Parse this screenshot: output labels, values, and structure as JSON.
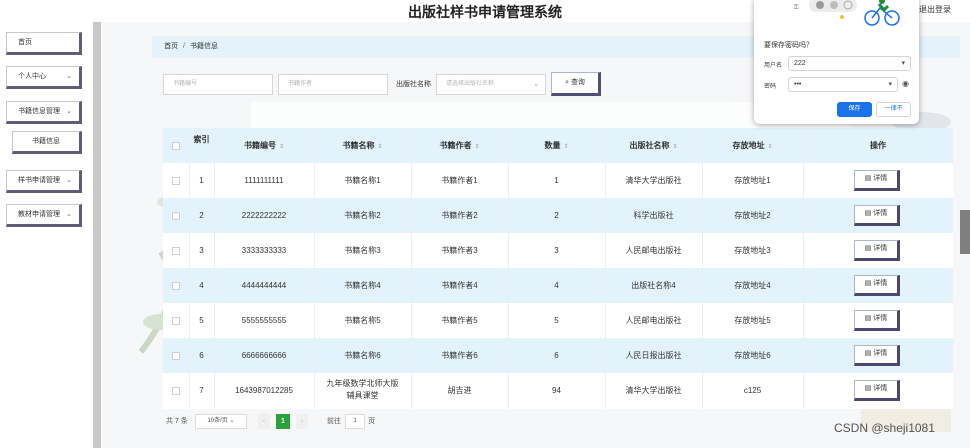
{
  "app": {
    "title": "出版社样书申请管理系统",
    "logout": "退出登录"
  },
  "sidebar": {
    "items": [
      {
        "label": "首页",
        "has_chevron": false,
        "sub": false
      },
      {
        "label": "个人中心",
        "has_chevron": true,
        "sub": false
      },
      {
        "label": "书籍信息管理",
        "has_chevron": true,
        "sub": false
      },
      {
        "label": "书籍信息",
        "has_chevron": false,
        "sub": true
      },
      {
        "label": "样书申请管理",
        "has_chevron": true,
        "sub": false
      },
      {
        "label": "教材申请管理",
        "has_chevron": true,
        "sub": false
      }
    ],
    "chevron_glyph": "⌄"
  },
  "breadcrumb": {
    "home": "首页",
    "separator": "/",
    "current": "书籍信息"
  },
  "filters": {
    "book_no_placeholder": "书籍编号",
    "author_placeholder": "书籍作者",
    "publisher_label": "出版社名称",
    "publisher_placeholder": "请选择出版社名称",
    "query_button": "查询"
  },
  "table": {
    "columns": [
      "索引",
      "书籍编号",
      "书籍名称",
      "书籍作者",
      "数量",
      "出版社名称",
      "存放地址",
      "操作"
    ],
    "rows": [
      {
        "index": "1",
        "book_no": "1111111111",
        "name": "书籍名称1",
        "author": "书籍作者1",
        "qty": "1",
        "publisher": "清华大学出版社",
        "address": "存放地址1"
      },
      {
        "index": "2",
        "book_no": "2222222222",
        "name": "书籍名称2",
        "author": "书籍作者2",
        "qty": "2",
        "publisher": "科学出版社",
        "address": "存放地址2"
      },
      {
        "index": "3",
        "book_no": "3333333333",
        "name": "书籍名称3",
        "author": "书籍作者3",
        "qty": "3",
        "publisher": "人民邮电出版社",
        "address": "存放地址3"
      },
      {
        "index": "4",
        "book_no": "4444444444",
        "name": "书籍名称4",
        "author": "书籍作者4",
        "qty": "4",
        "publisher": "出版社名称4",
        "address": "存放地址4"
      },
      {
        "index": "5",
        "book_no": "5555555555",
        "name": "书籍名称5",
        "author": "书籍作者5",
        "qty": "5",
        "publisher": "人民邮电出版社",
        "address": "存放地址5"
      },
      {
        "index": "6",
        "book_no": "6666666666",
        "name": "书籍名称6",
        "author": "书籍作者6",
        "qty": "6",
        "publisher": "人民日报出版社",
        "address": "存放地址6"
      },
      {
        "index": "7",
        "book_no": "1643987012285",
        "name": "九年级数学北师大版辅具课堂",
        "author": "胡吉进",
        "qty": "94",
        "publisher": "清华大学出版社",
        "address": "c125"
      }
    ],
    "detail_button": "详情"
  },
  "pagination": {
    "total": "共 7 条",
    "page_size": "10条/页",
    "current_page": "1",
    "goto_label": "前往",
    "goto_value": "1",
    "page_suffix": "页"
  },
  "password_popup": {
    "title": "要保存密码吗？",
    "username_label": "用户名",
    "username_value": "222",
    "password_label": "密码",
    "password_value": "•••",
    "save_button": "保存",
    "never_button": "一律不"
  },
  "watermark": "CSDN @sheji1081",
  "colors": {
    "accent_blue": "#1a73e8",
    "pager_green": "#2aa23c",
    "row_highlight": "#e3f3fb",
    "button_shadow": "#4a4871"
  }
}
